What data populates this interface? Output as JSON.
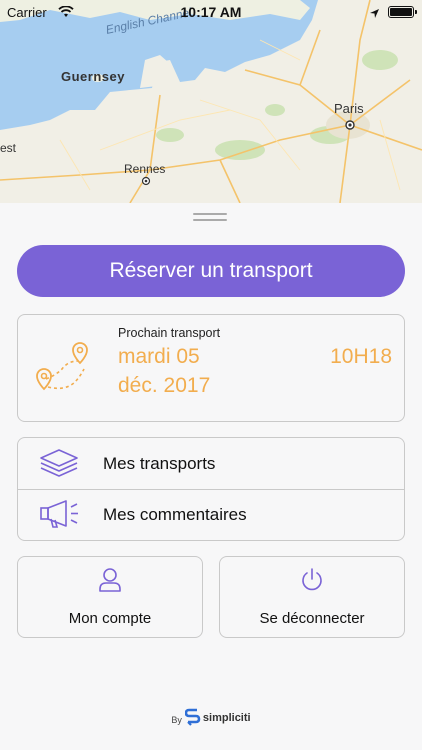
{
  "status_bar": {
    "carrier": "Carrier",
    "time": "10:17 AM"
  },
  "map": {
    "labels": {
      "channel": "English Channel",
      "guernsey": "Guernsey",
      "paris": "Paris",
      "rennes": "Rennes",
      "brest_partial": "est"
    }
  },
  "main": {
    "reserve_label": "Réserver un transport",
    "next_transport": {
      "label": "Prochain transport",
      "date_line1": "mardi 05",
      "date_line2": "déc. 2017",
      "time": "10H18"
    },
    "menu": [
      {
        "label": "Mes transports",
        "icon": "layers-icon"
      },
      {
        "label": "Mes commentaires",
        "icon": "megaphone-icon"
      }
    ],
    "tiles": [
      {
        "label": "Mon compte",
        "icon": "user-icon"
      },
      {
        "label": "Se déconnecter",
        "icon": "power-icon"
      }
    ]
  },
  "footer": {
    "by": "By",
    "brand": "simpliciti",
    "brand_icon": "simpliciti-logo-icon"
  },
  "colors": {
    "accent": "#7a63d6",
    "highlight": "#f2ad4e",
    "border": "#c9c9c9",
    "sea": "#a6cdf0",
    "land": "#f1efe6"
  }
}
